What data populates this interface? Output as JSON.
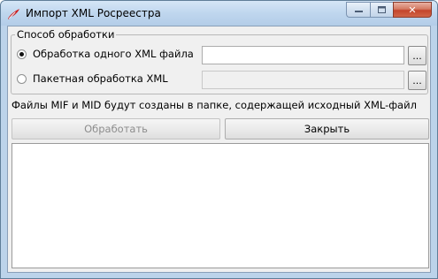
{
  "window": {
    "title": "Импорт XML Росреестра",
    "icon": "tk-feather-icon"
  },
  "title_buttons": {
    "minimize_icon": "minimize-icon",
    "maximize_icon": "maximize-icon",
    "close_icon": "close-icon",
    "close_glyph": "✕"
  },
  "processing_group": {
    "label": "Способ обработки",
    "options": [
      {
        "label": "Обработка одного XML файла",
        "checked": true,
        "file_value": ""
      },
      {
        "label": "Пакетная обработка XML",
        "checked": false,
        "file_value": ""
      }
    ],
    "browse_label": "..."
  },
  "info_text": "Файлы MIF и MID будут созданы в папке, содержащей исходный XML-файл",
  "buttons": {
    "process_label": "Обработать",
    "process_enabled": false,
    "close_label": "Закрыть"
  },
  "log": {
    "content": ""
  },
  "colors": {
    "title_bar": "#bfd6ee",
    "client_bg": "#f0f0f0",
    "close_button": "#c4452b",
    "disabled_text": "#8d8d8d",
    "icon_red": "#cc1f1f"
  }
}
